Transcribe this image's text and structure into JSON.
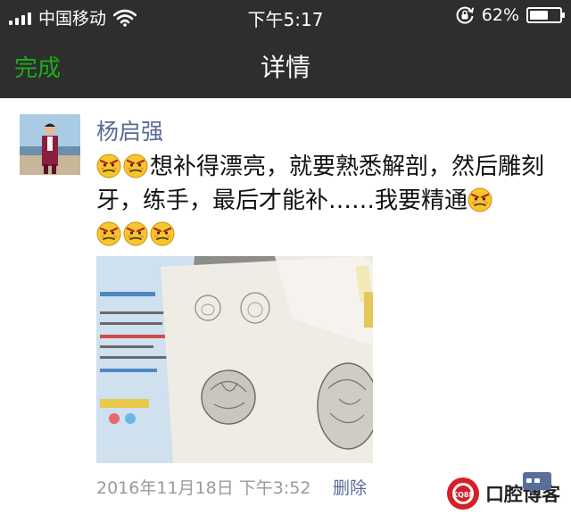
{
  "status_bar": {
    "carrier": "中国移动",
    "time": "下午5:17",
    "battery_percent": "62%",
    "battery_level": 0.62
  },
  "nav": {
    "back_label": "完成",
    "title": "详情"
  },
  "post": {
    "author": "杨启强",
    "text_main": "想补得漂亮，就要熟悉解剖，然后雕刻牙，练手，最后才能补……我要精通",
    "timestamp": "2016年11月18日 下午3:52",
    "delete_label": "删除"
  },
  "watermark": {
    "logo_text": "KQ88",
    "text": "口腔博客"
  },
  "colors": {
    "nav_bg": "#2e2e2e",
    "accent_green": "#1aad19",
    "link_blue": "#576b95",
    "meta_gray": "#9a9a9a"
  },
  "icons": [
    "signal-icon",
    "wifi-icon",
    "rotation-lock-icon",
    "battery-icon",
    "grimace-emoji-icon",
    "kq88-logo-icon"
  ]
}
